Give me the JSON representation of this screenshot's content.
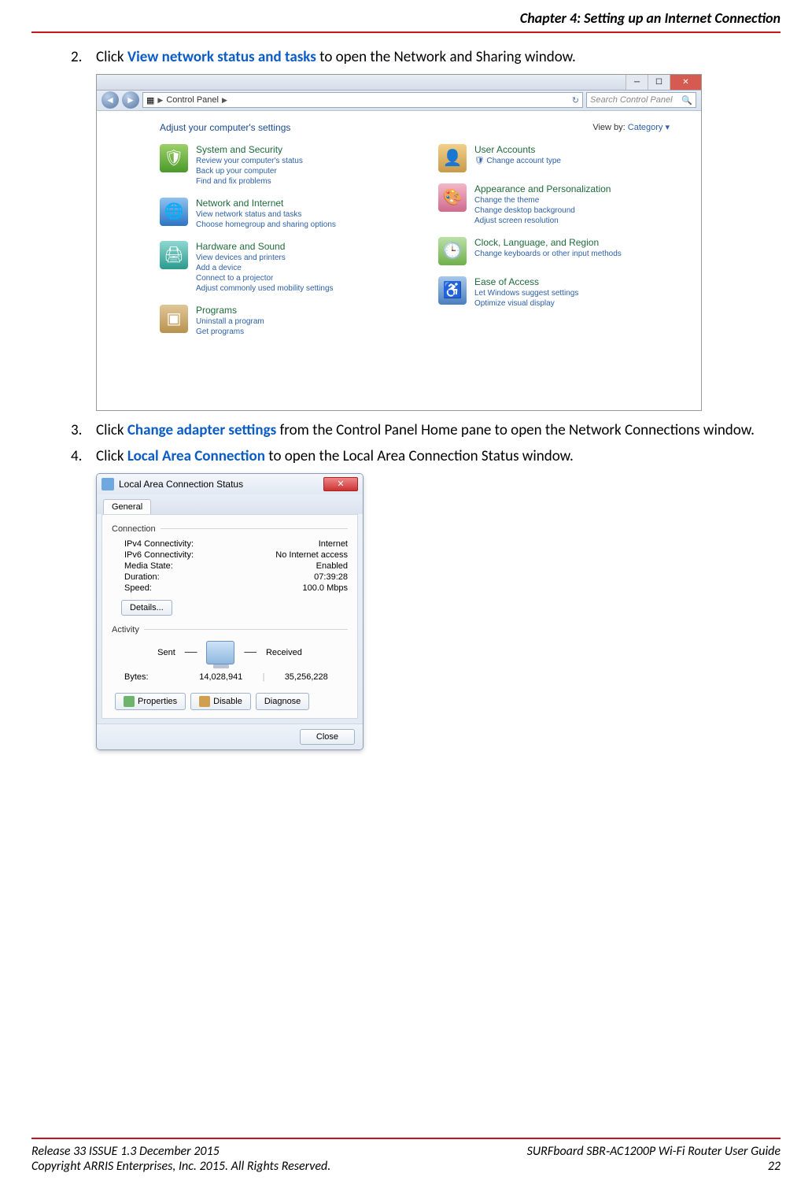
{
  "header": {
    "chapter_title": "Chapter 4: Setting up an Internet Connection"
  },
  "steps": {
    "s2": {
      "num": "2.",
      "pre": "Click ",
      "link": "View network status and tasks",
      "post": " to open the Network and Sharing window."
    },
    "s3": {
      "num": "3.",
      "pre": "Click ",
      "link": "Change adapter settings",
      "post": " from the Control Panel Home pane to open the Network Connections window."
    },
    "s4": {
      "num": "4.",
      "pre": "Click ",
      "link": "Local Area Connection",
      "post": " to open the Local Area Connection Status window."
    }
  },
  "control_panel": {
    "breadcrumb": "Control Panel",
    "search_placeholder": "Search Control Panel",
    "adjust_label": "Adjust your computer's settings",
    "viewby_label": "View by:",
    "viewby_value": "Category",
    "left": [
      {
        "title": "System and Security",
        "subs": [
          "Review your computer's status",
          "Back up your computer",
          "Find and fix problems"
        ],
        "icon": "ic-green",
        "glyph": "🛡"
      },
      {
        "title": "Network and Internet",
        "subs": [
          "View network status and tasks",
          "Choose homegroup and sharing options"
        ],
        "icon": "ic-blue",
        "glyph": "🌐"
      },
      {
        "title": "Hardware and Sound",
        "subs": [
          "View devices and printers",
          "Add a device",
          "Connect to a projector",
          "Adjust commonly used mobility settings"
        ],
        "icon": "ic-teal",
        "glyph": "🖨"
      },
      {
        "title": "Programs",
        "subs": [
          "Uninstall a program",
          "Get programs"
        ],
        "icon": "ic-tan",
        "glyph": "▣"
      }
    ],
    "right": [
      {
        "title": "User Accounts",
        "subs": [
          "Change account type"
        ],
        "icon": "ic-user",
        "glyph": "👤",
        "badge": true
      },
      {
        "title": "Appearance and Personalization",
        "subs": [
          "Change the theme",
          "Change desktop background",
          "Adjust screen resolution"
        ],
        "icon": "ic-pink",
        "glyph": "🎨"
      },
      {
        "title": "Clock, Language, and Region",
        "subs": [
          "Change keyboards or other input methods"
        ],
        "icon": "ic-clock",
        "glyph": "🕒"
      },
      {
        "title": "Ease of Access",
        "subs": [
          "Let Windows suggest settings",
          "Optimize visual display"
        ],
        "icon": "ic-ease",
        "glyph": "♿"
      }
    ]
  },
  "lac": {
    "title": "Local Area Connection Status",
    "tab": "General",
    "group_connection": "Connection",
    "group_activity": "Activity",
    "rows": {
      "ipv4_l": "IPv4 Connectivity:",
      "ipv4_v": "Internet",
      "ipv6_l": "IPv6 Connectivity:",
      "ipv6_v": "No Internet access",
      "media_l": "Media State:",
      "media_v": "Enabled",
      "dur_l": "Duration:",
      "dur_v": "07:39:28",
      "spd_l": "Speed:",
      "spd_v": "100.0 Mbps"
    },
    "details_btn": "Details...",
    "sent_label": "Sent",
    "recv_label": "Received",
    "bytes_label": "Bytes:",
    "bytes_sent": "14,028,941",
    "bytes_recv": "35,256,228",
    "props_btn": "Properties",
    "disable_btn": "Disable",
    "diag_btn": "Diagnose",
    "close_btn": "Close"
  },
  "footer": {
    "left1": "Release 33 ISSUE 1.3    December 2015",
    "right1": "SURFboard SBR‑AC1200P Wi-Fi Router User Guide",
    "left2": "Copyright ARRIS Enterprises, Inc. 2015. All Rights Reserved.",
    "right2": "22"
  }
}
